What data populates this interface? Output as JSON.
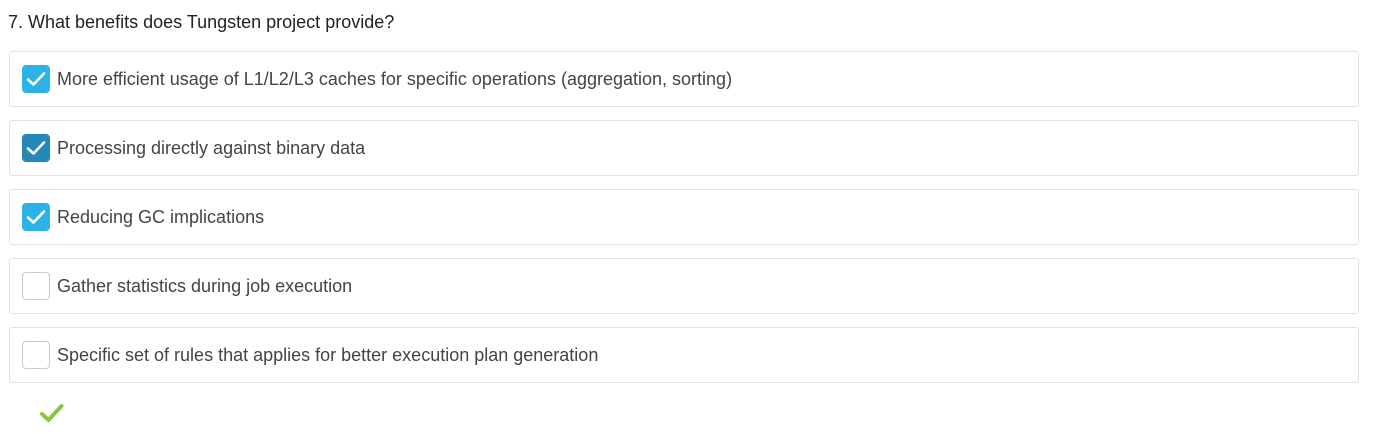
{
  "question": {
    "title": "7. What benefits does Tungsten project provide?"
  },
  "options": [
    {
      "label": "More efficient usage of L1/L2/L3 caches for specific operations (aggregation, sorting)",
      "checked": true
    },
    {
      "label": "Processing directly against binary data",
      "checked": true
    },
    {
      "label": "Reducing GC implications",
      "checked": true
    },
    {
      "label": "Gather statistics during job execution",
      "checked": false
    },
    {
      "label": "Specific set of rules that applies for better execution plan generation",
      "checked": false
    }
  ],
  "result": {
    "icon": "check-mark-icon",
    "status": "correct",
    "color": "#8cc63f"
  },
  "colors": {
    "checkbox_checked": "#2bb3e8",
    "checkbox_checked_hover": "#2489b8",
    "option_border": "#e2e2e2"
  }
}
